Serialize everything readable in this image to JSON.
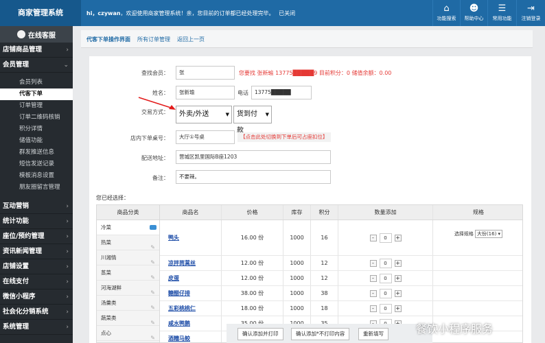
{
  "app": {
    "brand": "商家管理系统"
  },
  "header": {
    "welcome_user": "hi，czywan",
    "welcome_msg": "，欢迎使用商家管理系统！亲，您目前的订单都已经处理完毕。",
    "close_label": "已关闭",
    "icons": [
      {
        "label": "功能搜索",
        "icon": "home-icon"
      },
      {
        "label": "帮助中心",
        "icon": "help-icon"
      },
      {
        "label": "常用功能",
        "icon": "menu-icon"
      },
      {
        "label": "注销登录",
        "icon": "logout-icon"
      }
    ]
  },
  "sidebar": {
    "status": "在线客服",
    "groups_top": [
      "店铺商品管理",
      "会员管理"
    ],
    "sub_items": [
      "会员列表",
      "代客下单",
      "订单管理",
      "订单二维码核销",
      "积分详情",
      "储值功能",
      "群发推送信息",
      "短信发送记录",
      "模板消息设置",
      "朋友圈留言管理"
    ],
    "active_sub": "代客下单",
    "groups_bottom": [
      "互动营销",
      "统计功能",
      "座位/预约管理",
      "资讯新闻管理",
      "店铺设置",
      "在线支付",
      "微信小程序",
      "社会化分销系统",
      "系统管理"
    ]
  },
  "tabs": [
    "代客下单操作界面",
    "所有订单管理",
    "返回上一页"
  ],
  "form": {
    "search_label": "查找会员：",
    "search_value": "张",
    "search_result": "您要找 张新瑜 13775█████9 目前积分：0 储值余额：0.00",
    "name_label": "姓名：",
    "name_value": "张新瑜",
    "phone_label": "电话",
    "phone_value": "13775█████",
    "trade_label": "交易方式：",
    "trade_type": "外卖/外送",
    "pay_type": "货到付款",
    "table_label": "店内下单桌号：",
    "table_value": "大厅①号桌",
    "table_hint": "【点击此处切换到下单后可占座扣位】",
    "addr_label": "配送地址：",
    "addr_value": "营城区凯里国际B座1203",
    "note_label": "备注：",
    "note_value": "不要辣。"
  },
  "selected_title": "您已经选择：",
  "table": {
    "cat_header": "商品分类",
    "headers": [
      "商品名",
      "价格",
      "库存",
      "积分",
      "数量添加",
      "规格"
    ],
    "categories": [
      "冷菜",
      "热菜",
      "川湘情",
      "蒸菜",
      "河海湖鲜",
      "汤羹类",
      "蔬菜类",
      "点心"
    ],
    "active_category": "冷菜",
    "rows": [
      {
        "name": "鸭头",
        "price": "16.00 份",
        "stock": "1000",
        "points": "16",
        "qty": "0",
        "spec_label": "选择规格",
        "spec_value": "大份(16)"
      },
      {
        "name": "凉拌茼蒿丝",
        "price": "12.00 份",
        "stock": "1000",
        "points": "12",
        "qty": "0"
      },
      {
        "name": "皮蛋",
        "price": "12.00 份",
        "stock": "1000",
        "points": "12",
        "qty": "0"
      },
      {
        "name": "糖醋仔排",
        "price": "38.00 份",
        "stock": "1000",
        "points": "38",
        "qty": "0"
      },
      {
        "name": "五彩桃桃仁",
        "price": "18.00 份",
        "stock": "1000",
        "points": "18",
        "qty": "0"
      },
      {
        "name": "咸水鸭鹅",
        "price": "35.00 份",
        "stock": "1000",
        "points": "35",
        "qty": "0"
      },
      {
        "name": "酒糟马鲛",
        "price": "",
        "stock": "",
        "points": "",
        "qty": ""
      }
    ]
  },
  "actions": [
    "确认添加并打印",
    "确认添加*不打印内容",
    "重新填写"
  ],
  "watermark": "餐饮小程序服务"
}
